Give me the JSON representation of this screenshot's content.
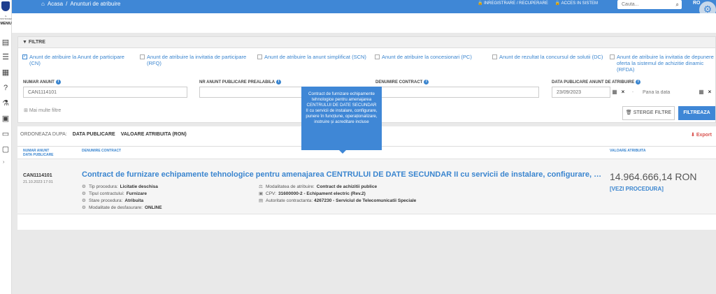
{
  "header": {
    "breadcrumb": {
      "home": "Acasa",
      "separator": "/",
      "current": "Anunturi de atribuire"
    },
    "links": {
      "register": "INREGISTRARE / RECUPERARE",
      "access": "ACCES IN SISTEM"
    },
    "search": {
      "placeholder": "Cauta..."
    },
    "language": "RO"
  },
  "rail": {
    "tiny_text": "A-INSTRUMENTE",
    "menu_label": "MENIU"
  },
  "filters": {
    "title": "FILTRE",
    "checkboxes": [
      {
        "label": "Anunt de atribuire la Anunt de participare (CN)",
        "checked": true
      },
      {
        "label": "Anunt de atribuire la invitatia de participare (RFQ)",
        "checked": false
      },
      {
        "label": "Anunt de atribuire la anunt simplificat (SCN)",
        "checked": false
      },
      {
        "label": "Anunt de atribuire la concesionari (PC)",
        "checked": false
      },
      {
        "label": "Anunt de rezultat la concursul de solutii (DC)",
        "checked": false
      },
      {
        "label": "Anunt de atribuire la invitatia de depunere oferta la sistemul de achizitie dinamic (RFDA)",
        "checked": false
      }
    ],
    "fields": {
      "notice_number": {
        "label": "NUMAR ANUNT",
        "value": "CAN1114101"
      },
      "prior_notice": {
        "label": "NR ANUNT PUBLICARE PREALABILA",
        "value": ""
      },
      "contract_name": {
        "label": "DENUMIRE CONTRACT",
        "value": ""
      },
      "award_date": {
        "label": "DATA PUBLICARE ANUNT DE ATRIBUIRE",
        "from": "23/09/2023",
        "to_placeholder": "Pana la data",
        "separator": "-"
      }
    },
    "more_filters": "Mai multe filtre",
    "clear_button": "STERGE FILTRE",
    "filter_button": "FILTREAZA"
  },
  "results": {
    "sort_label": "ORDONEAZA DUPA:",
    "sort_options": [
      "DATA PUBLICARE",
      "VALOARE ATRIBUITA (RON)"
    ],
    "export": "Export",
    "columns": {
      "number": "NUMAR ANUNT",
      "date": "DATA PUBLICARE",
      "name": "DENUMIRE CONTRACT",
      "value": "VALOARE ATRIBUITA"
    },
    "row": {
      "id": "CAN1114101",
      "date": "21.10.2023 17:01",
      "title": "Contract de furnizare echipamente tehnologice pentru amenajarea CENTRULUI DE DATE SECUNDAR II cu servicii de instalare, configurare, punere in functiune, operationalizare, instruire si acreditare incluse",
      "value": "14.964.666,14",
      "currency": "RON",
      "link": "[VEZI PROCEDURA]",
      "meta_left": [
        {
          "label": "Tip procedura:",
          "value": "Licitatie deschisa"
        },
        {
          "label": "Tipul contractului:",
          "value": "Furnizare"
        },
        {
          "label": "Stare procedura:",
          "value": "Atribuita"
        },
        {
          "label": "Modalitate de desfasurare:",
          "value": "ONLINE"
        }
      ],
      "meta_right": [
        {
          "label": "Modalitatea de atribuire:",
          "value": "Contract de achizitii publice"
        },
        {
          "label": "CPV:",
          "value": "31600000-2 - Echipament electric (Rev.2)"
        },
        {
          "label": "Autoritate contractanta:",
          "value": "4267230 - Serviciul de Telecomunicatii Speciale"
        }
      ]
    }
  },
  "tooltip": {
    "text": "Contract de furnizare echipamente tehnologice pentru amenajarea CENTRULUI DE DATE SECUNDAR II cu servicii de instalare, configurare, punere în funcțiune, operaționalizare, instruire și acreditare incluse"
  },
  "colors": {
    "primary": "#3f87d6",
    "link": "#3a85cf",
    "export": "#d9534f"
  }
}
